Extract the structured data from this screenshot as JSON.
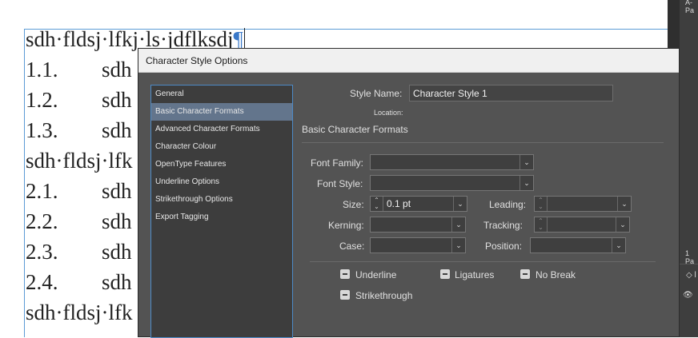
{
  "document": {
    "lines": [
      {
        "num": "",
        "text": "sdh·fldsj·lfkj·ls·jdflksdj",
        "mark": "¶"
      },
      {
        "num": "1.1.",
        "text": "sdh"
      },
      {
        "num": "1.2.",
        "text": "sdh"
      },
      {
        "num": "1.3.",
        "text": "sdh"
      },
      {
        "num": "",
        "text": "sdh·fldsj·lfk"
      },
      {
        "num": "2.1.",
        "text": "sdh"
      },
      {
        "num": "2.2.",
        "text": "sdh"
      },
      {
        "num": "2.3.",
        "text": "sdh"
      },
      {
        "num": "2.4.",
        "text": "sdh"
      },
      {
        "num": "",
        "text": "sdh·fldsj·lfk"
      }
    ]
  },
  "right_panel": {
    "top_label": "A-Pa",
    "pages_label": "1 Pa",
    "arrows": "◇ l",
    "eye": "👁"
  },
  "dialog": {
    "title": "Character Style Options",
    "nav": [
      {
        "label": "General",
        "selected": false
      },
      {
        "label": "Basic Character Formats",
        "selected": true
      },
      {
        "label": "Advanced Character Formats",
        "selected": false
      },
      {
        "label": "Character Colour",
        "selected": false
      },
      {
        "label": "OpenType Features",
        "selected": false
      },
      {
        "label": "Underline Options",
        "selected": false
      },
      {
        "label": "Strikethrough Options",
        "selected": false
      },
      {
        "label": "Export Tagging",
        "selected": false
      }
    ],
    "style_name_label": "Style Name:",
    "style_name_value": "Character Style 1",
    "location_label": "Location:",
    "section_title": "Basic Character Formats",
    "font_family_label": "Font Family:",
    "font_family_value": "",
    "font_style_label": "Font Style:",
    "font_style_value": "",
    "size_label": "Size:",
    "size_value": "0.1 pt",
    "leading_label": "Leading:",
    "leading_value": "",
    "kerning_label": "Kerning:",
    "kerning_value": "",
    "tracking_label": "Tracking:",
    "tracking_value": "",
    "case_label": "Case:",
    "case_value": "",
    "position_label": "Position:",
    "position_value": "",
    "checkboxes": {
      "underline": "Underline",
      "ligatures": "Ligatures",
      "no_break": "No Break",
      "strikethrough": "Strikethrough"
    },
    "icons": {
      "dropdown": "chevron-down-icon",
      "spinner": "spinner-icon",
      "checkbox_state": "indeterminate"
    },
    "colors": {
      "dialog_bg": "#535353",
      "nav_selected": "#63758c",
      "nav_border": "#4d8ac6",
      "frame": "#5b9bd5"
    }
  }
}
